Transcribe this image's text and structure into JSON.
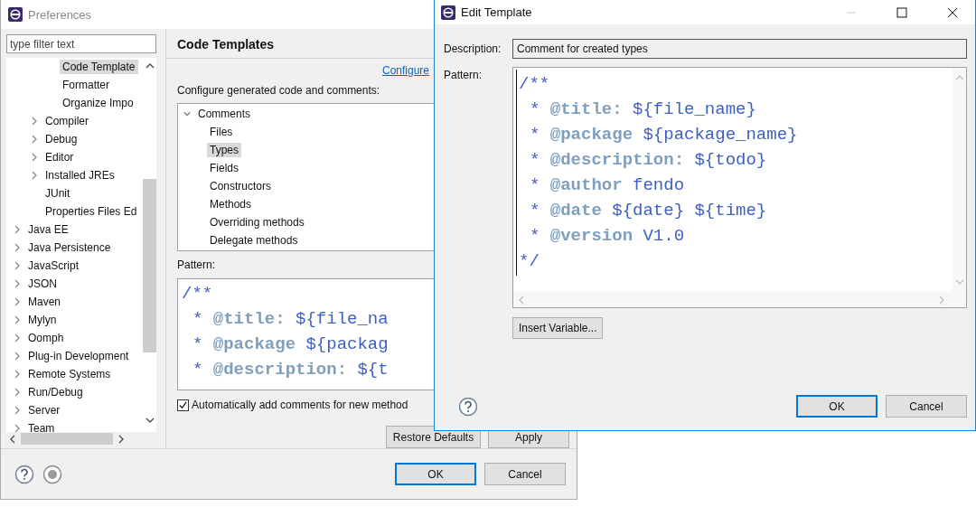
{
  "preferences": {
    "title": "Preferences",
    "filter": {
      "placeholder": "type filter text"
    },
    "tree": [
      {
        "children": [
          {
            "children": [
              {
                "label": "Code Template",
                "expandable": false,
                "selected": true
              },
              {
                "label": "Formatter",
                "expandable": false,
                "selected": false
              },
              {
                "label": "Organize Impo",
                "expandable": false,
                "selected": false
              }
            ]
          },
          {
            "label": "Compiler",
            "expandable": true,
            "selected": false
          },
          {
            "label": "Debug",
            "expandable": true,
            "selected": false
          },
          {
            "label": "Editor",
            "expandable": true,
            "selected": false
          },
          {
            "label": "Installed JREs",
            "expandable": true,
            "selected": false
          },
          {
            "label": "JUnit",
            "expandable": false,
            "selected": false
          },
          {
            "label": "Properties Files Ed",
            "expandable": false,
            "selected": false
          }
        ]
      },
      {
        "label": "Java EE",
        "expandable": true,
        "selected": false
      },
      {
        "label": "Java Persistence",
        "expandable": true,
        "selected": false
      },
      {
        "label": "JavaScript",
        "expandable": true,
        "selected": false
      },
      {
        "label": "JSON",
        "expandable": true,
        "selected": false
      },
      {
        "label": "Maven",
        "expandable": true,
        "selected": false
      },
      {
        "label": "Mylyn",
        "expandable": true,
        "selected": false
      },
      {
        "label": "Oomph",
        "expandable": true,
        "selected": false
      },
      {
        "label": "Plug-in Development",
        "expandable": true,
        "selected": false
      },
      {
        "label": "Remote Systems",
        "expandable": true,
        "selected": false
      },
      {
        "label": "Run/Debug",
        "expandable": true,
        "selected": false
      },
      {
        "label": "Server",
        "expandable": true,
        "selected": false
      },
      {
        "label": "Team",
        "expandable": true,
        "selected": false
      }
    ],
    "page_title": "Code Templates",
    "configure_link": "Configure",
    "intro": "Configure generated code and comments:",
    "templates": [
      {
        "label": "Comments",
        "expanded": true,
        "selected": false,
        "children": [
          {
            "label": "Files",
            "selected": false
          },
          {
            "label": "Types",
            "selected": true
          },
          {
            "label": "Fields",
            "selected": false
          },
          {
            "label": "Constructors",
            "selected": false
          },
          {
            "label": "Methods",
            "selected": false
          },
          {
            "label": "Overriding methods",
            "selected": false
          },
          {
            "label": "Delegate methods",
            "selected": false
          }
        ]
      }
    ],
    "pattern_label": "Pattern:",
    "pattern": [
      {
        "kind": "open",
        "prefix": "/**"
      },
      {
        "kind": "item",
        "prefix": "*",
        "tag": "@title:",
        "value": "${file_na"
      },
      {
        "kind": "item",
        "prefix": "*",
        "tag": "@package",
        "value": "${packag"
      },
      {
        "kind": "item",
        "prefix": "*",
        "tag": "@description:",
        "value": "${t"
      }
    ],
    "auto_comments": {
      "label": "Automatically add comments for new method",
      "checked": true
    },
    "page_buttons": [
      "Restore Defaults",
      "Apply"
    ],
    "buttons": [
      {
        "label": "OK",
        "default": true
      },
      {
        "label": "Cancel",
        "default": false
      }
    ]
  },
  "edit_template": {
    "title": "Edit Template",
    "description_label": "Description:",
    "description": "Comment for created types",
    "pattern_label": "Pattern:",
    "pattern": [
      {
        "kind": "open",
        "prefix": "/**"
      },
      {
        "kind": "item",
        "prefix": "*",
        "tag": "@title:",
        "value": "${file_name}"
      },
      {
        "kind": "item",
        "prefix": "*",
        "tag": "@package",
        "value": "${package_name}"
      },
      {
        "kind": "item",
        "prefix": "*",
        "tag": "@description:",
        "value": "${todo}"
      },
      {
        "kind": "item",
        "prefix": "*",
        "tag": "@author",
        "value": "fendo"
      },
      {
        "kind": "item",
        "prefix": "*",
        "tag": "@date",
        "value": "${date} ${time}"
      },
      {
        "kind": "item",
        "prefix": "*",
        "tag": "@version",
        "value": "V1.0"
      },
      {
        "kind": "close",
        "prefix": "*/"
      }
    ],
    "insert_button": "Insert Variable...",
    "buttons": [
      {
        "label": "OK",
        "default": true
      },
      {
        "label": "Cancel",
        "default": false
      }
    ]
  }
}
